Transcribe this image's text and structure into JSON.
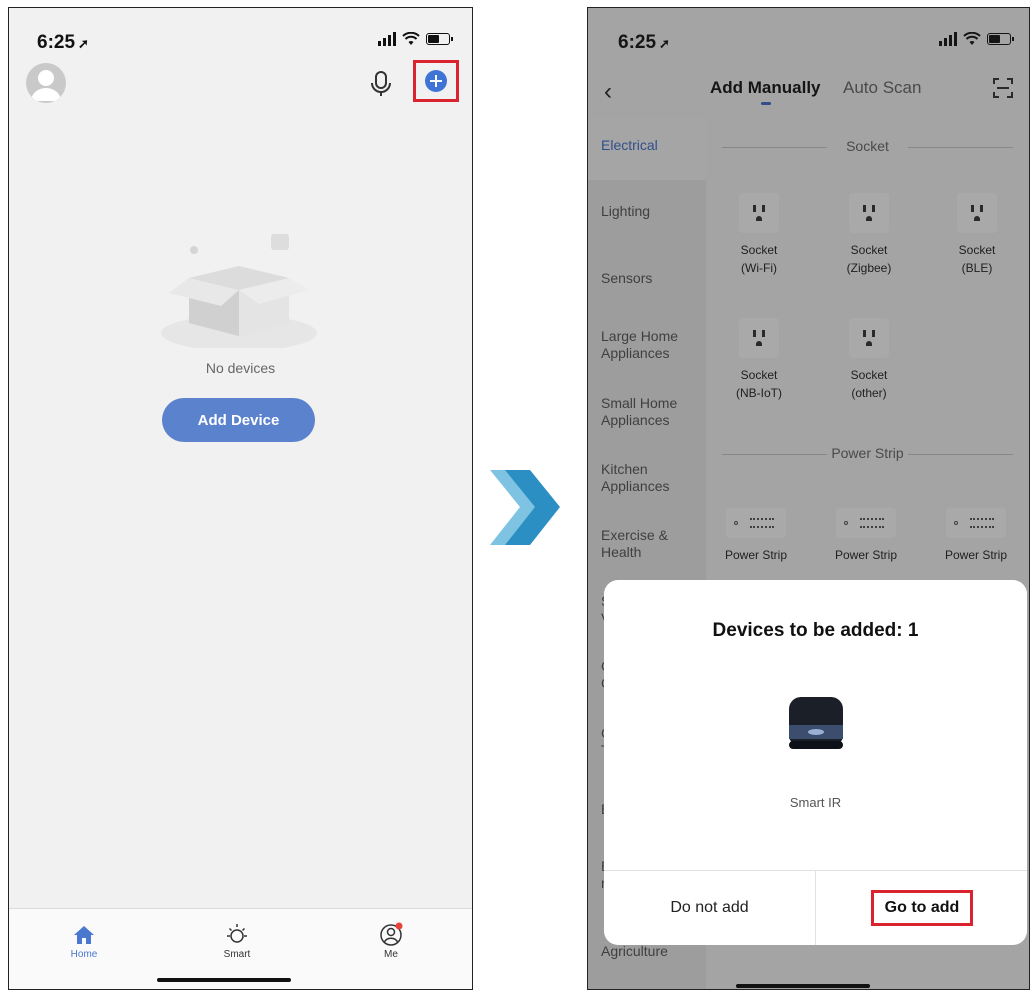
{
  "left_screen": {
    "status": {
      "time": "6:25"
    },
    "empty_state": {
      "message": "No devices",
      "add_button": "Add Device"
    },
    "tabs": [
      {
        "label": "Home",
        "icon": "home-icon",
        "active": true
      },
      {
        "label": "Smart",
        "icon": "sun-icon",
        "active": false
      },
      {
        "label": "Me",
        "icon": "profile-icon",
        "active": false
      }
    ],
    "colors": {
      "accent": "#3d74d6",
      "button": "#5b82cc",
      "highlight": "#d9232e"
    }
  },
  "right_screen": {
    "status": {
      "time": "6:25"
    },
    "nav": {
      "tab_active": "Add Manually",
      "tab_other": "Auto Scan"
    },
    "categories": [
      "Electrical",
      "Lighting",
      "Sensors",
      "Large Home Appliances",
      "Small Home Appliances",
      "Kitchen Appliances",
      "Exercise & Health",
      "S V",
      "C C",
      "C T",
      "E",
      "E n",
      "Agriculture"
    ],
    "sections": {
      "socket_title": "Socket",
      "sockets": [
        {
          "line1": "Socket",
          "line2": "(Wi-Fi)"
        },
        {
          "line1": "Socket",
          "line2": "(Zigbee)"
        },
        {
          "line1": "Socket",
          "line2": "(BLE)"
        },
        {
          "line1": "Socket",
          "line2": "(NB-IoT)"
        },
        {
          "line1": "Socket",
          "line2": "(other)"
        }
      ],
      "power_strip_title": "Power Strip",
      "power_strips": [
        "Power Strip",
        "Power Strip",
        "Power Strip"
      ]
    },
    "modal": {
      "title": "Devices to be added: 1",
      "device_name": "Smart IR",
      "cancel_label": "Do not add",
      "confirm_label": "Go to add"
    }
  }
}
